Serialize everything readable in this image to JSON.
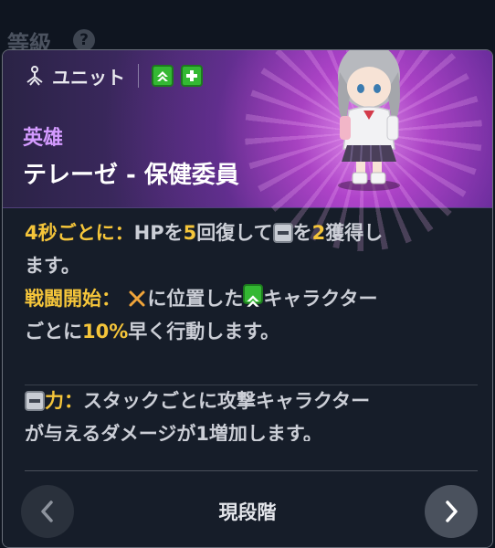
{
  "background": {
    "label": "等級",
    "help": "?"
  },
  "header": {
    "unit_label": "ユニット",
    "rarity": "英雄",
    "name": "テレーゼ - 保健委員"
  },
  "skill": {
    "p1_prefix": "4秒ごとに",
    "p1_colon": "：",
    "p1_a": "HPを",
    "p1_num1": "5",
    "p1_b": "回復して",
    "p1_c": "を",
    "p1_num2": "2",
    "p1_d": "獲得し",
    "p1_e": "ます。",
    "p2_prefix": "戦闘開始",
    "p2_colon": "：",
    "p2_a": "に位置した",
    "p2_b": "キャラクター",
    "p2_c": "ごとに",
    "p2_pct": "10%",
    "p2_d": "早く行動します。"
  },
  "keyword": {
    "name": "力",
    "colon": "：",
    "desc1": "スタックごとに攻撃キャラクター",
    "desc2": "が与えるダメージが1増加します。"
  },
  "footer": {
    "stage_label": "現段階"
  },
  "colors": {
    "accent_yellow": "#f5c53a",
    "rarity_purple": "#d49bff",
    "class_green": "#34b833"
  }
}
